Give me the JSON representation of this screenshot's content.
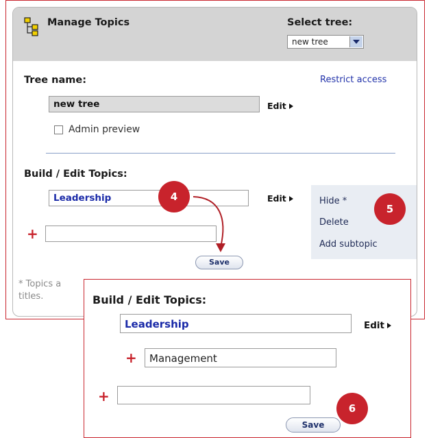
{
  "header": {
    "title": "Manage Topics",
    "select_tree_label": "Select tree:",
    "select_tree_value": "new tree"
  },
  "tree": {
    "name_label": "Tree name:",
    "restrict_access": "Restrict access",
    "name_value": "new tree",
    "edit_label": "Edit",
    "admin_preview_label": "Admin preview"
  },
  "build": {
    "heading": "Build / Edit Topics:",
    "topic_value": "Leadership",
    "edit_label": "Edit",
    "new_topic_value": "",
    "save_label": "Save",
    "footnote_line1": "* Topics a",
    "footnote_line2": "titles."
  },
  "context_menu": {
    "items": [
      "Hide *",
      "Delete",
      "Add subtopic"
    ]
  },
  "callouts": {
    "four": "4",
    "five": "5",
    "six": "6"
  },
  "zoom": {
    "heading": "Build / Edit Topics:",
    "topic_value": "Leadership",
    "edit_label": "Edit",
    "subtopic_value": "Management",
    "new_topic_value": "",
    "save_label": "Save"
  },
  "colors": {
    "accent_red": "#c8232c",
    "link_blue": "#2233aa",
    "header_gray": "#d4d4d4"
  }
}
